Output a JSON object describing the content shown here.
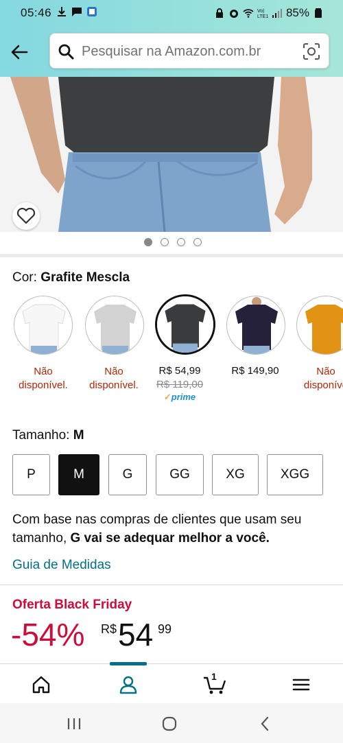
{
  "status_bar": {
    "time": "05:46",
    "battery": "85%"
  },
  "search": {
    "placeholder": "Pesquisar na Amazon.com.br"
  },
  "image_carousel": {
    "dot_count": 4,
    "active_index": 0
  },
  "color": {
    "label": "Cor:",
    "selected_name": "Grafite Mescla",
    "swatches": [
      {
        "color": "#f4f4f4",
        "status": "Não disponível.",
        "status_lines": [
          "Não",
          "disponível."
        ]
      },
      {
        "color": "#d2d2d2",
        "status": "Não disponível.",
        "status_lines": [
          "Não",
          "disponível."
        ]
      },
      {
        "color": "#3a3b3d",
        "price": "R$ 54,99",
        "old_price": "R$ 119,00",
        "badge": "prime",
        "selected": true
      },
      {
        "color": "#26213a",
        "price": "R$ 149,90"
      },
      {
        "color": "#e19315",
        "status_lines": [
          "Não",
          "disponíve"
        ]
      }
    ]
  },
  "size": {
    "label": "Tamanho:",
    "selected": "M",
    "options": [
      "P",
      "M",
      "G",
      "GG",
      "XG",
      "XGG"
    ]
  },
  "fit": {
    "text_before": "Com base nas compras de clientes que usam seu tamanho, ",
    "text_bold": "G vai se adequar melhor a você."
  },
  "guide_link": "Guia de Medidas",
  "deal": {
    "label": "Oferta Black Friday",
    "discount": "-54%",
    "currency": "R$",
    "price_whole": "54",
    "price_fraction": "99"
  },
  "bottom_nav": {
    "items": [
      "home-icon",
      "account-icon",
      "cart-icon",
      "menu-icon"
    ],
    "cart_count": "1",
    "active": "account-icon"
  },
  "colors": {
    "link": "#007185",
    "deal": "#cc0c39",
    "unavailable": "#b12704"
  }
}
